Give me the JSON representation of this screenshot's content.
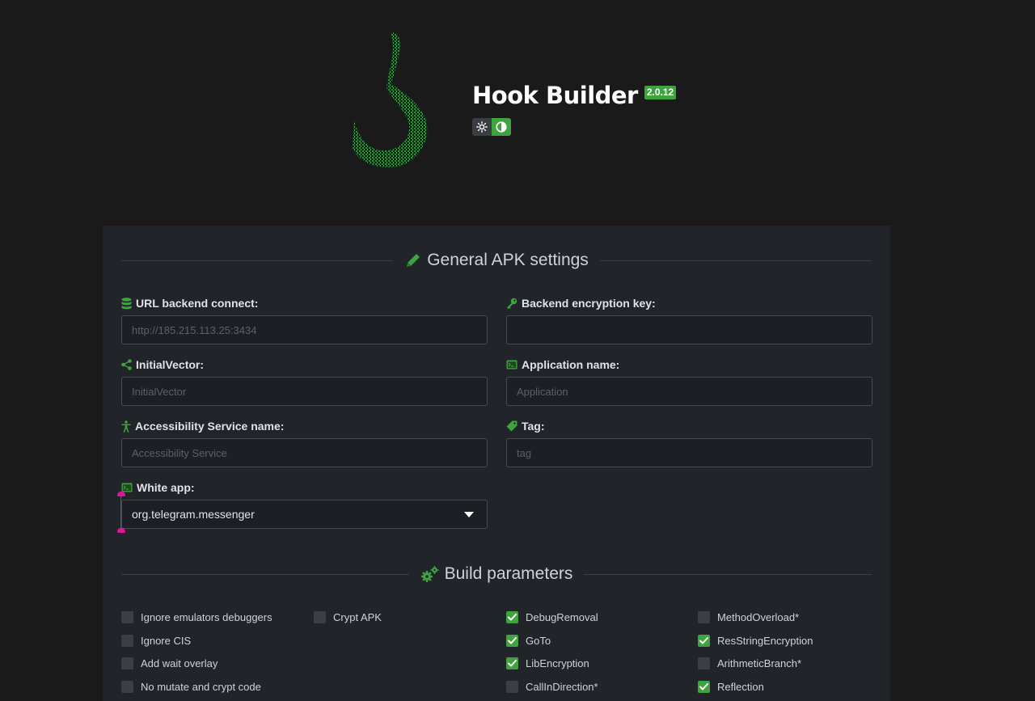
{
  "header": {
    "title": "Hook Builder",
    "version": "2.0.12"
  },
  "general": {
    "title": "General APK settings",
    "fields": {
      "url": {
        "label": "URL backend connect:",
        "placeholder": "http://185.215.113.25:3434"
      },
      "enc_key": {
        "label": "Backend encryption key:",
        "placeholder": ""
      },
      "iv": {
        "label": "InitialVector:",
        "placeholder": "InitialVector"
      },
      "app_name": {
        "label": "Application name:",
        "placeholder": "Application"
      },
      "acc_service": {
        "label": "Accessibility Service name:",
        "placeholder": "Accessibility Service"
      },
      "tag": {
        "label": "Tag:",
        "placeholder": "tag"
      },
      "white_app": {
        "label": "White app:",
        "value": "org.telegram.messenger"
      }
    }
  },
  "build": {
    "title": "Build parameters",
    "col1": [
      {
        "label": "Ignore emulators debuggers",
        "checked": false
      },
      {
        "label": "Ignore CIS",
        "checked": false
      },
      {
        "label": "Add wait overlay",
        "checked": false
      },
      {
        "label": "No mutate and crypt code",
        "checked": false
      }
    ],
    "col2": [
      {
        "label": "Crypt APK",
        "checked": false
      }
    ],
    "col3": [
      {
        "label": "DebugRemoval",
        "checked": true
      },
      {
        "label": "GoTo",
        "checked": true
      },
      {
        "label": "LibEncryption",
        "checked": true
      },
      {
        "label": "CallInDirection*",
        "checked": false
      }
    ],
    "col4": [
      {
        "label": "MethodOverload*",
        "checked": false
      },
      {
        "label": "ResStringEncryption",
        "checked": true
      },
      {
        "label": "ArithmeticBranch*",
        "checked": false
      },
      {
        "label": "Reflection",
        "checked": true
      }
    ]
  },
  "colors": {
    "accent": "#3fa33f",
    "background": "#1a1a1a",
    "panel": "#212428"
  }
}
